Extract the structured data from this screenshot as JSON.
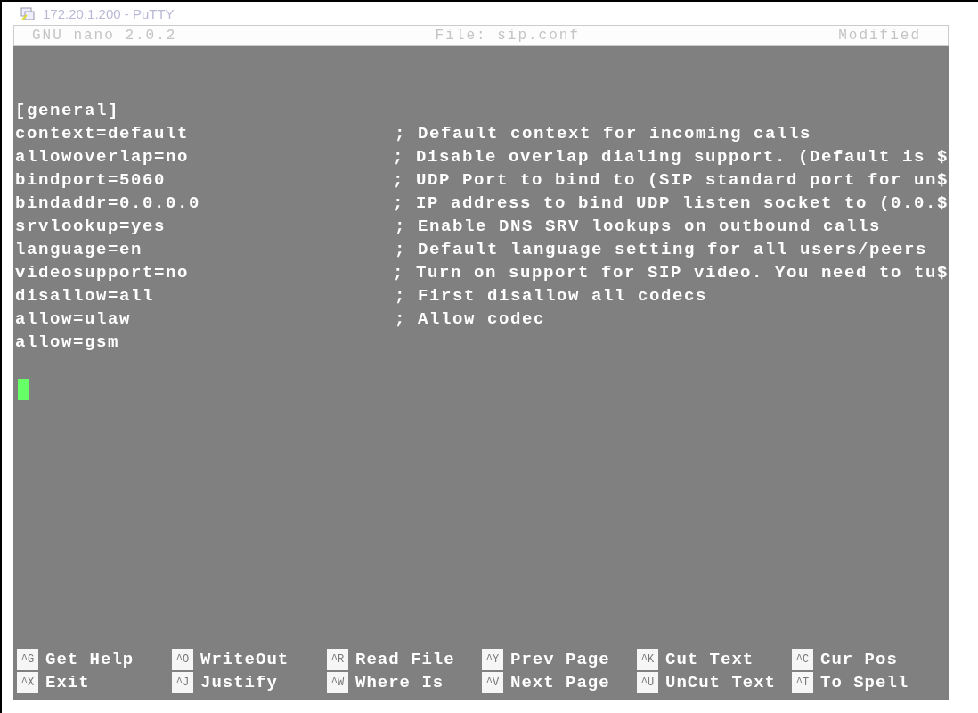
{
  "window": {
    "title": "172.20.1.200 - PuTTY"
  },
  "header": {
    "version": "GNU nano 2.0.2",
    "file": "File: sip.conf",
    "status": "Modified"
  },
  "lines": [
    {
      "setting": "[general]"
    },
    {
      "setting": "context=default",
      "comment": "; Default context for incoming calls"
    },
    {
      "setting": "allowoverlap=no",
      "comment": "; Disable overlap dialing support. (Default is $"
    },
    {
      "setting": "bindport=5060",
      "comment": "; UDP Port to bind to (SIP standard port for un$"
    },
    {
      "setting": "bindaddr=0.0.0.0",
      "comment": "; IP address to bind UDP listen socket to (0.0.$"
    },
    {
      "setting": "srvlookup=yes",
      "comment": "; Enable DNS SRV lookups on outbound calls"
    },
    {
      "setting": "language=en",
      "comment": "; Default language setting for all users/peers"
    },
    {
      "setting": "videosupport=no",
      "comment": "; Turn on support for SIP video. You need to tu$"
    },
    {
      "setting": "disallow=all",
      "comment": "; First disallow all codecs"
    },
    {
      "setting": "allow=ulaw",
      "comment": "; Allow codec"
    },
    {
      "setting": "allow=gsm"
    }
  ],
  "shortcuts": [
    {
      "key": "^G",
      "label": "Get Help"
    },
    {
      "key": "^O",
      "label": "WriteOut"
    },
    {
      "key": "^R",
      "label": "Read File"
    },
    {
      "key": "^Y",
      "label": "Prev Page"
    },
    {
      "key": "^K",
      "label": "Cut Text"
    },
    {
      "key": "^C",
      "label": "Cur Pos"
    },
    {
      "key": "^X",
      "label": "Exit"
    },
    {
      "key": "^J",
      "label": "Justify"
    },
    {
      "key": "^W",
      "label": "Where Is"
    },
    {
      "key": "^V",
      "label": "Next Page"
    },
    {
      "key": "^U",
      "label": "UnCut Text"
    },
    {
      "key": "^T",
      "label": "To Spell"
    }
  ]
}
